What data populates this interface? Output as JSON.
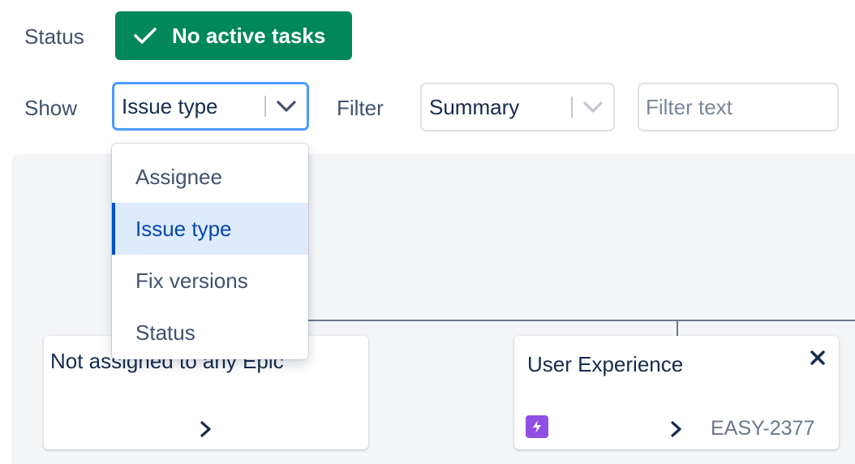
{
  "status": {
    "label": "Status",
    "badge_text": "No active tasks",
    "badge_color": "#00875a",
    "icon": "check-icon"
  },
  "show": {
    "label": "Show",
    "selected": "Issue type",
    "icon": "chevron-down-icon"
  },
  "filter": {
    "label": "Filter",
    "field_selected": "Summary",
    "text_placeholder": "Filter text",
    "text_value": ""
  },
  "menu": {
    "items": [
      {
        "label": "Assignee",
        "selected": false
      },
      {
        "label": "Issue type",
        "selected": true
      },
      {
        "label": "Fix versions",
        "selected": false
      },
      {
        "label": "Status",
        "selected": false
      }
    ]
  },
  "cards": [
    {
      "title": "Not assigned to any Epic",
      "key": "",
      "icon": "chevron-right-icon"
    },
    {
      "title": "User Experience",
      "key": "EASY-2377",
      "icon": "epic-icon",
      "close_icon": "close-icon"
    }
  ]
}
